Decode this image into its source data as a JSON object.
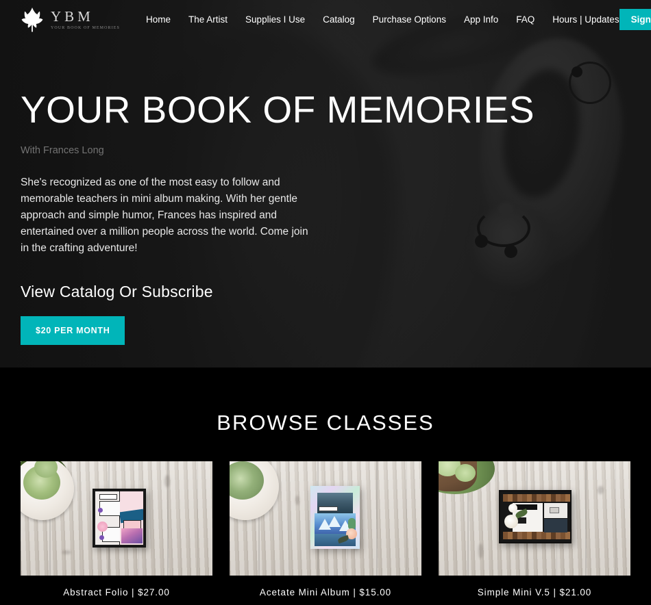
{
  "brand": {
    "icon": "leaf-icon",
    "title": "YBM",
    "tagline": "YOUR BOOK OF MEMORIES"
  },
  "nav": {
    "links": [
      {
        "label": "Home"
      },
      {
        "label": "The Artist"
      },
      {
        "label": "Supplies I Use"
      },
      {
        "label": "Catalog"
      },
      {
        "label": "Purchase Options"
      },
      {
        "label": "App Info"
      },
      {
        "label": "FAQ"
      },
      {
        "label": "Hours | Updates"
      }
    ],
    "signin_label": "Sign In"
  },
  "hero": {
    "title": "YOUR BOOK OF MEMORIES",
    "subtitle": "With Frances Long",
    "paragraph": "She's recognized as one of the most easy to follow and memorable teachers in mini album making. With her gentle approach and simple humor, Frances has inspired and entertained over a million people across the world. Come join in the crafting adventure!",
    "cta_heading": "View Catalog Or Subscribe",
    "price_button_label": "$20 PER MONTH"
  },
  "classes": {
    "heading": "BROWSE CLASSES",
    "cards": [
      {
        "caption": "Abstract Folio | $27.00",
        "image_alt": "abstract-folio-album-photo"
      },
      {
        "caption": "Acetate Mini Album | $15.00",
        "image_alt": "acetate-mini-album-photo"
      },
      {
        "caption": "Simple Mini V.5 | $21.00",
        "image_alt": "simple-mini-v5-album-photo"
      }
    ]
  },
  "colors": {
    "accent_teal": "#01b5b9",
    "hero_background": "#1c1c1c",
    "page_background": "#000000",
    "subtitle_gray": "#737373"
  }
}
